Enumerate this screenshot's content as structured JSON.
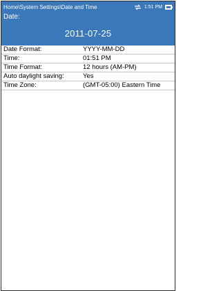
{
  "statusbar": {
    "breadcrumb": "Home\\System Settings\\Date and Time",
    "time": "1:51 PM",
    "icons": [
      "sync-icon",
      "battery-icon"
    ]
  },
  "date_panel": {
    "label": "Date:",
    "value": "2011-07-25"
  },
  "settings": [
    {
      "label": "Date Format:",
      "value": "YYYY-MM-DD"
    },
    {
      "label": "Time:",
      "value": "01:51 PM"
    },
    {
      "label": "Time Format:",
      "value": "12 hours (AM-PM)"
    },
    {
      "label": "Auto daylight saving:",
      "value": "Yes"
    },
    {
      "label": "Time Zone:",
      "value": "(GMT-05:00) Eastern Time"
    }
  ],
  "colors": {
    "accent": "#3a78b9",
    "row_border": "#c8c8c8",
    "frame_border": "#2a2a2a"
  }
}
